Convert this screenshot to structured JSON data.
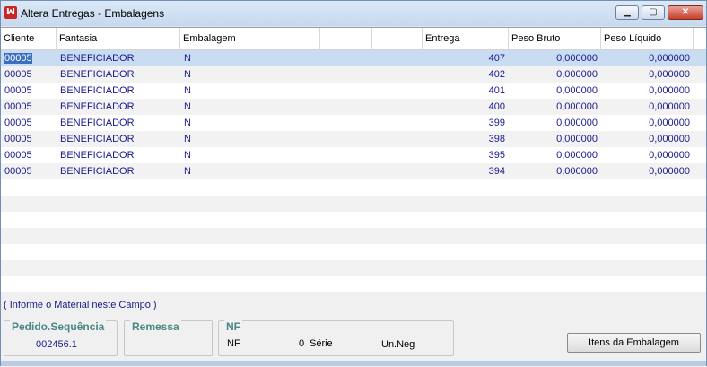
{
  "window": {
    "title": "Altera Entregas - Embalagens",
    "app_icon": "ꟽ",
    "minimize_glyph": "▁",
    "maximize_glyph": "▢",
    "close_glyph": "✕"
  },
  "grid": {
    "columns": [
      "Cliente",
      "Fantasia",
      "Embalagem",
      "",
      "",
      "Entrega",
      "Peso Bruto",
      "Peso Líquido"
    ],
    "rows": [
      {
        "cliente": "00005",
        "fantasia": "BENEFICIADOR",
        "embalagem": "N",
        "entrega": "407",
        "peso_bruto": "0,000000",
        "peso_liquido": "0,000000"
      },
      {
        "cliente": "00005",
        "fantasia": "BENEFICIADOR",
        "embalagem": "N",
        "entrega": "402",
        "peso_bruto": "0,000000",
        "peso_liquido": "0,000000"
      },
      {
        "cliente": "00005",
        "fantasia": "BENEFICIADOR",
        "embalagem": "N",
        "entrega": "401",
        "peso_bruto": "0,000000",
        "peso_liquido": "0,000000"
      },
      {
        "cliente": "00005",
        "fantasia": "BENEFICIADOR",
        "embalagem": "N",
        "entrega": "400",
        "peso_bruto": "0,000000",
        "peso_liquido": "0,000000"
      },
      {
        "cliente": "00005",
        "fantasia": "BENEFICIADOR",
        "embalagem": "N",
        "entrega": "399",
        "peso_bruto": "0,000000",
        "peso_liquido": "0,000000"
      },
      {
        "cliente": "00005",
        "fantasia": "BENEFICIADOR",
        "embalagem": "N",
        "entrega": "398",
        "peso_bruto": "0,000000",
        "peso_liquido": "0,000000"
      },
      {
        "cliente": "00005",
        "fantasia": "BENEFICIADOR",
        "embalagem": "N",
        "entrega": "395",
        "peso_bruto": "0,000000",
        "peso_liquido": "0,000000"
      },
      {
        "cliente": "00005",
        "fantasia": "BENEFICIADOR",
        "embalagem": "N",
        "entrega": "394",
        "peso_bruto": "0,000000",
        "peso_liquido": "0,000000"
      }
    ]
  },
  "hint": "( Informe o Material neste Campo )",
  "pedido": {
    "label": "Pedido.Sequência",
    "value": "002456.1"
  },
  "remessa": {
    "label": "Remessa"
  },
  "nf": {
    "label": "NF",
    "nf_label": "NF",
    "nf_value": "0",
    "serie_label": "Série",
    "unneg_label": "Un.Neg"
  },
  "buttons": {
    "itens": "Itens da Embalagem"
  },
  "colors": {
    "link_text": "#1a1a8c",
    "selection": "#c9dcf2",
    "legend": "#4a8787"
  }
}
